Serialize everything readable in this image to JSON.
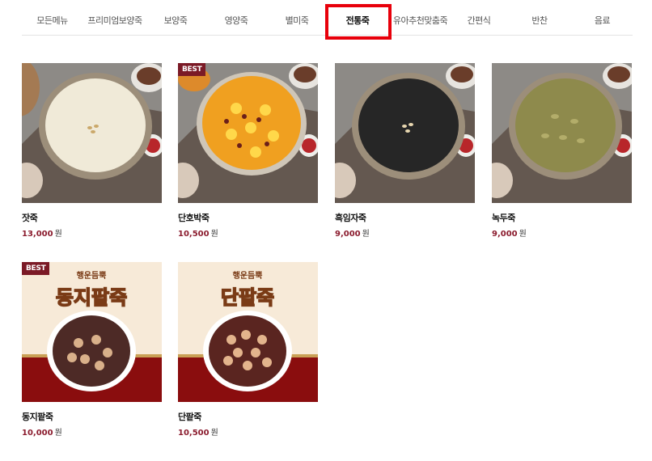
{
  "tabs": [
    {
      "label": "모든메뉴"
    },
    {
      "label": "프리미엄보양죽"
    },
    {
      "label": "보양죽"
    },
    {
      "label": "영양죽"
    },
    {
      "label": "별미죽"
    },
    {
      "label": "전통죽",
      "active": true
    },
    {
      "label": "유아추천맞춤죽"
    },
    {
      "label": "간편식"
    },
    {
      "label": "반찬"
    },
    {
      "label": "음료"
    }
  ],
  "currency_unit": "원",
  "products": [
    {
      "name": "잣죽",
      "price": "13,000",
      "badge": "",
      "image": "pine-nut-porridge-image"
    },
    {
      "name": "단호박죽",
      "price": "10,500",
      "badge": "BEST",
      "image": "sweet-pumpkin-porridge-image"
    },
    {
      "name": "흑임자죽",
      "price": "9,000",
      "badge": "",
      "image": "black-sesame-porridge-image"
    },
    {
      "name": "녹두죽",
      "price": "9,000",
      "badge": "",
      "image": "mung-bean-porridge-image"
    },
    {
      "name": "동지팥죽",
      "price": "10,000",
      "badge": "BEST",
      "image": "dongji-red-bean-porridge-image",
      "banner": "동지팥죽",
      "banner_top": "행운듬뿍"
    },
    {
      "name": "단팥죽",
      "price": "10,500",
      "badge": "",
      "image": "sweet-red-bean-porridge-image",
      "banner": "단팥죽",
      "banner_top": "행운듬뿍"
    }
  ],
  "colors": {
    "accent": "#8b1c2e",
    "highlight": "#e8000b",
    "badge": "#7b1a26"
  }
}
